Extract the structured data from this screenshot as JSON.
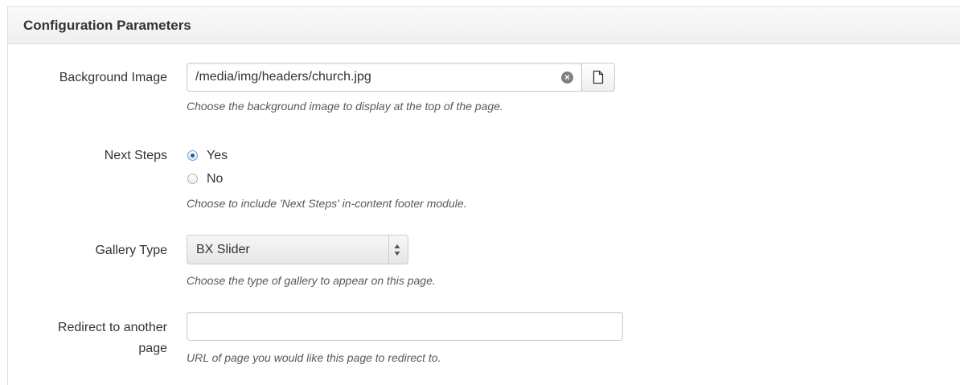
{
  "panel": {
    "title": "Configuration Parameters"
  },
  "fields": {
    "background_image": {
      "label": "Background Image",
      "value": "/media/img/headers/church.jpg",
      "help": "Choose the background image to display at the top of the page.",
      "clear_icon": "clear-circle-icon",
      "browse_icon": "file-icon"
    },
    "next_steps": {
      "label": "Next Steps",
      "options": [
        {
          "label": "Yes",
          "checked": true
        },
        {
          "label": "No",
          "checked": false
        }
      ],
      "help": "Choose to include 'Next Steps' in-content footer module."
    },
    "gallery_type": {
      "label": "Gallery Type",
      "selected": "BX Slider",
      "help": "Choose the type of gallery to appear on this page.",
      "arrow_icon": "select-arrows-icon"
    },
    "redirect": {
      "label_line1": "Redirect to another",
      "label_line2": "page",
      "value": "",
      "help": "URL of page you would like this page to redirect to."
    }
  },
  "colors": {
    "radio_accent": "#2a5c9a",
    "help_text": "#595959",
    "border": "#cccccc"
  }
}
